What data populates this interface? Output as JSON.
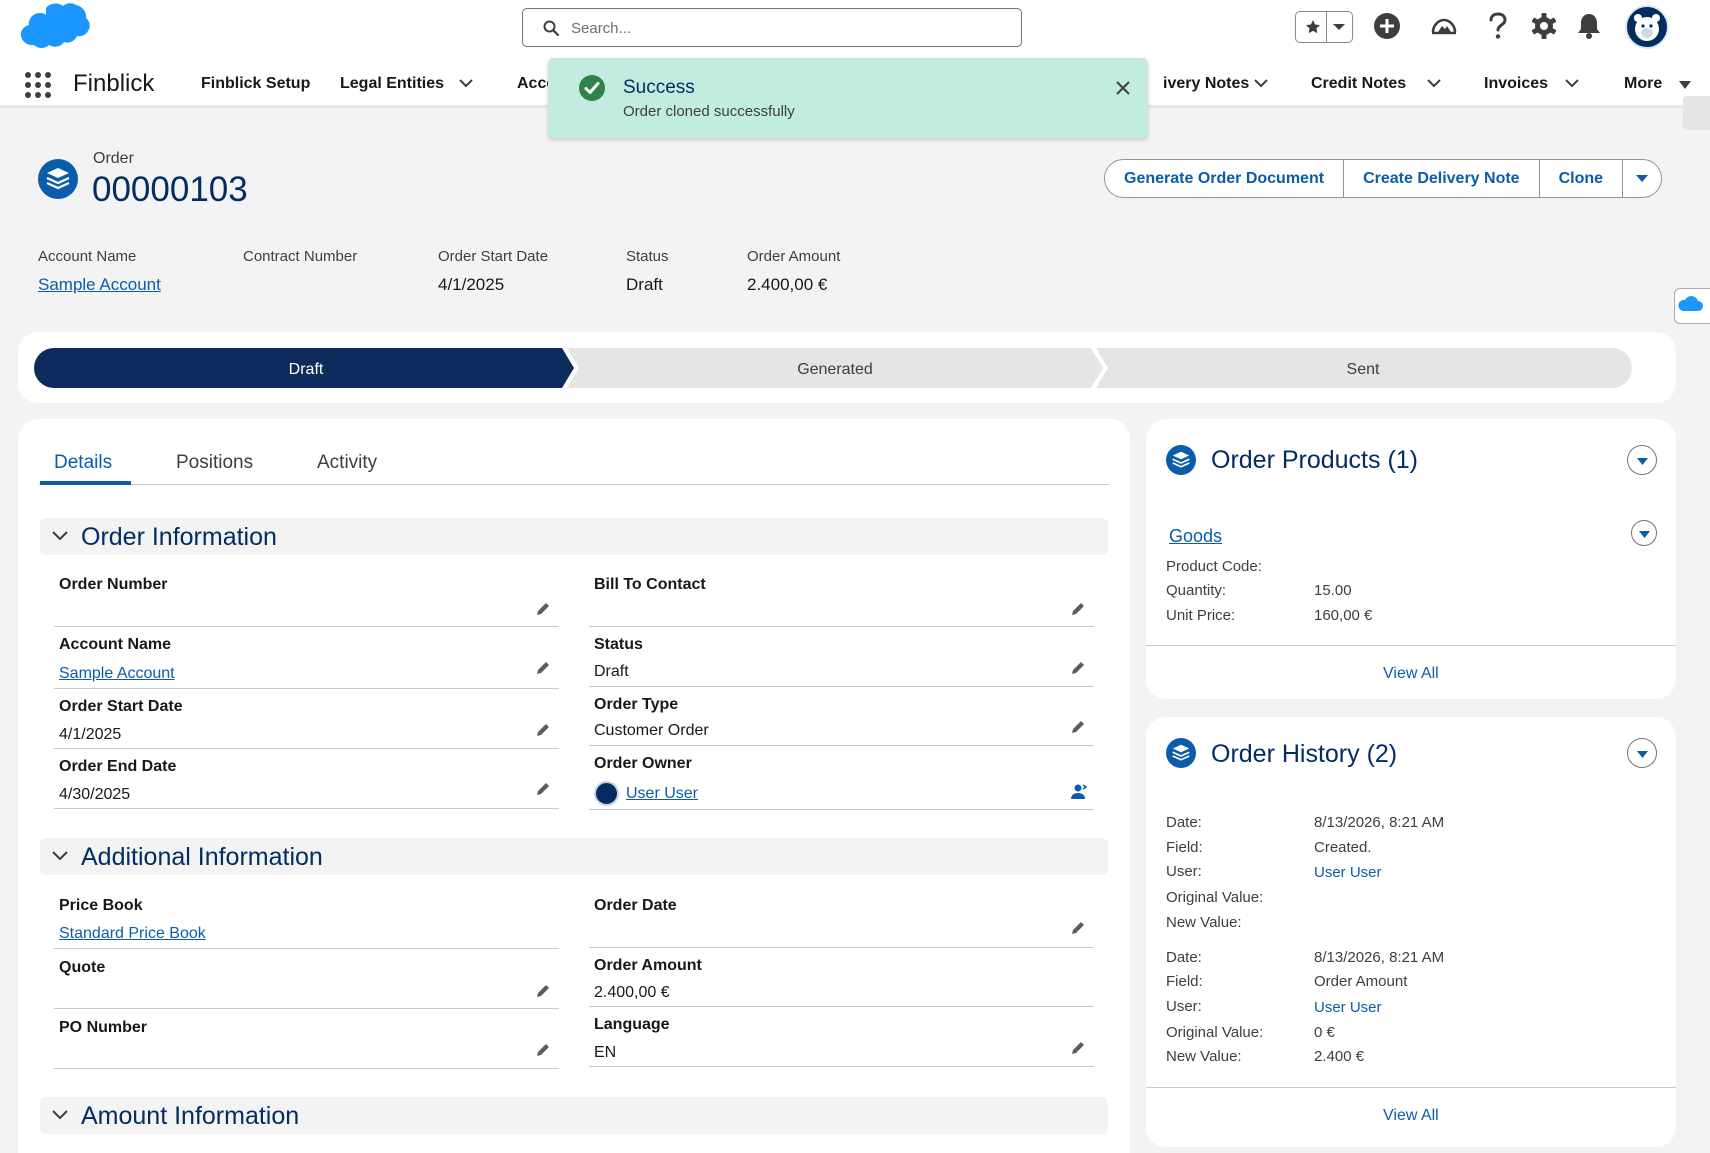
{
  "header": {
    "search_placeholder": "Search...",
    "icons": [
      "favorites-icon",
      "add-icon",
      "trailhead-icon",
      "help-icon",
      "setup-gear-icon",
      "notifications-bell-icon",
      "avatar"
    ]
  },
  "nav": {
    "app_name": "Finblick",
    "items": [
      {
        "label": "Finblick Setup",
        "has_menu": false
      },
      {
        "label": "Legal Entities",
        "has_menu": true
      },
      {
        "label": "Acco",
        "has_menu": true
      },
      {
        "label": "ivery Notes",
        "has_menu": true
      },
      {
        "label": "Credit Notes",
        "has_menu": true
      },
      {
        "label": "Invoices",
        "has_menu": true
      },
      {
        "label": "More",
        "has_menu": true
      }
    ]
  },
  "toast": {
    "title": "Success",
    "message": "Order cloned successfully",
    "color": "#c3ece0"
  },
  "record": {
    "object_type": "Order",
    "name": "00000103",
    "actions": [
      "Generate Order Document",
      "Create Delivery Note",
      "Clone"
    ],
    "highlights": [
      {
        "label": "Account Name",
        "value": "Sample Account",
        "link": true
      },
      {
        "label": "Contract Number",
        "value": "",
        "link": false
      },
      {
        "label": "Order Start Date",
        "value": "4/1/2025",
        "link": false
      },
      {
        "label": "Status",
        "value": "Draft",
        "link": false
      },
      {
        "label": "Order Amount",
        "value": "2.400,00 €",
        "link": false
      }
    ]
  },
  "path": {
    "stages": [
      "Draft",
      "Generated",
      "Sent"
    ],
    "current": "Draft",
    "active_color": "#0d2b5c"
  },
  "tabs": {
    "items": [
      "Details",
      "Positions",
      "Activity"
    ],
    "active": "Details"
  },
  "sections": {
    "order_info": {
      "title": "Order Information",
      "left": [
        {
          "label": "Order Number",
          "value": ""
        },
        {
          "label": "Account Name",
          "value": "Sample Account"
        },
        {
          "label": "Order Start Date",
          "value": "4/1/2025"
        },
        {
          "label": "Order End Date",
          "value": "4/30/2025"
        }
      ],
      "right": [
        {
          "label": "Bill To Contact",
          "value": ""
        },
        {
          "label": "Status",
          "value": "Draft"
        },
        {
          "label": "Order Type",
          "value": "Customer Order"
        },
        {
          "label": "Order Owner",
          "value": "User User"
        }
      ]
    },
    "additional_info": {
      "title": "Additional Information",
      "left": [
        {
          "label": "Price Book",
          "value": "Standard Price Book"
        },
        {
          "label": "Quote",
          "value": ""
        },
        {
          "label": "PO Number",
          "value": ""
        }
      ],
      "right": [
        {
          "label": "Order Date",
          "value": ""
        },
        {
          "label": "Order Amount",
          "value": "2.400,00 €"
        },
        {
          "label": "Language",
          "value": "EN"
        }
      ]
    },
    "amount_info": {
      "title": "Amount Information"
    }
  },
  "order_products": {
    "title": "Order Products (1)",
    "product_name": "Goods",
    "labels": [
      "Product Code:",
      "Quantity:",
      "Unit Price:"
    ],
    "values": [
      "",
      "15.00",
      "160,00 €"
    ],
    "view_all": "View All"
  },
  "order_history": {
    "title": "Order History (2)",
    "labels": [
      "Date:",
      "Field:",
      "User:",
      "Original Value:",
      "New Value:"
    ],
    "entries": [
      {
        "date": "8/13/2026, 8:21 AM",
        "field": "Created.",
        "user": "User User",
        "original": "",
        "new": ""
      },
      {
        "date": "8/13/2026, 8:21 AM",
        "field": "Order Amount",
        "user": "User User",
        "original": "0 €",
        "new": "2.400 €"
      }
    ],
    "view_all": "View All"
  },
  "colors": {
    "brand_blue": "#0b5cab",
    "heading_navy": "#032d60",
    "salesforce_cloud": "#1b96ff",
    "page_bg": "#f3f3f3"
  }
}
